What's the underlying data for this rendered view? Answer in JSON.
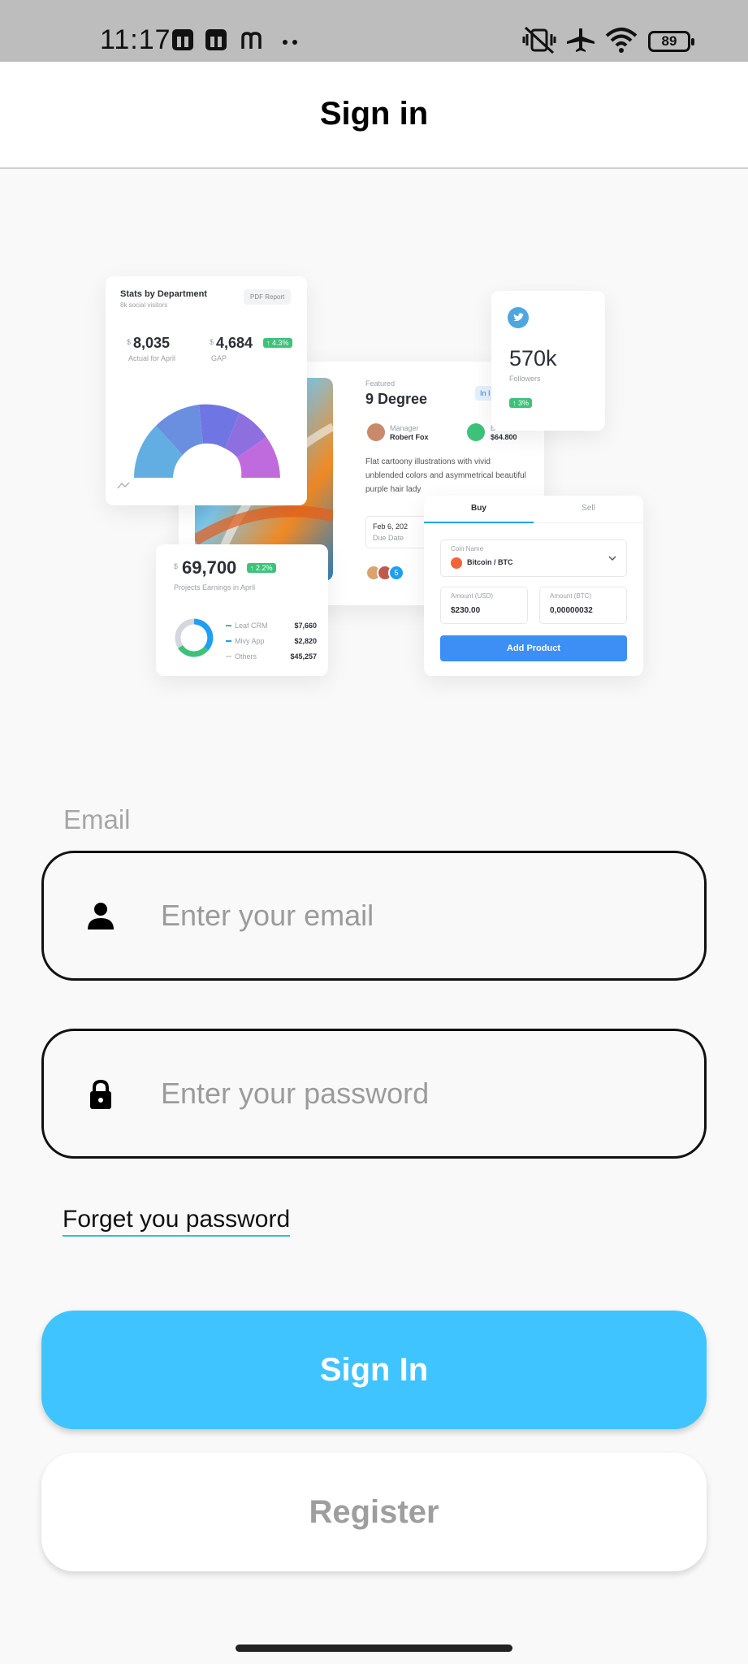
{
  "status_bar": {
    "time": "11:17",
    "battery": "89",
    "icons": [
      "notification-app-icon",
      "notification-app-icon",
      "m-app-icon",
      "more-dots-icon",
      "vibrate-off-icon",
      "airplane-icon",
      "wifi-icon",
      "battery-icon"
    ]
  },
  "appbar": {
    "title": "Sign in"
  },
  "illustration": {
    "stats_card": {
      "title": "Stats by Department",
      "subtitle": "8k social visitors",
      "report_button": "PDF Report",
      "value1_currency": "$",
      "value1": "8,035",
      "value1_label": "Actual for April",
      "value2_currency": "$",
      "value2": "4,684",
      "value2_badge": "↑ 4.3%",
      "value2_label": "GAP"
    },
    "featured_card": {
      "label": "Featured",
      "title": "9 Degree",
      "tag": "In I",
      "manager_label": "Manager",
      "manager_name": "Robert Fox",
      "budget_label": "B",
      "budget_value": "$64.800",
      "description": "Flat cartoony illustrations with vivid unblended colors and asymmetrical beautiful purple hair lady",
      "date": "Feb 6, 202",
      "date_label": "Due Date",
      "avatar_extra": "5"
    },
    "twitter_card": {
      "value": "570k",
      "label": "Followers",
      "badge": "↑ 3%"
    },
    "earnings_card": {
      "currency": "$",
      "value": "69,700",
      "badge": "↑ 2.2%",
      "label": "Projects Earnings in April",
      "rows": [
        {
          "name": "Leaf CRM",
          "value": "$7,660",
          "color": "#3ec27a"
        },
        {
          "name": "Mivy App",
          "value": "$2,820",
          "color": "#1e9ff2"
        },
        {
          "name": "Others",
          "value": "$45,257",
          "color": "#d4d8de"
        }
      ]
    },
    "trade_card": {
      "tab_buy": "Buy",
      "tab_sell": "Sell",
      "coin_label": "Coin Name",
      "coin_value": "Bitcoin / BTC",
      "usd_label": "Amount (USD)",
      "usd_value": "$230.00",
      "btc_label": "Amount (BTC)",
      "btc_value": "0,00000032",
      "button": "Add Product"
    }
  },
  "form": {
    "email_label": "Email",
    "email_placeholder": "Enter your email",
    "email_value": "",
    "password_placeholder": "Enter your password",
    "password_value": "",
    "forgot_link": "Forget you password",
    "signin_button": "Sign In",
    "register_button": "Register"
  },
  "colors": {
    "accent": "#40c4ff",
    "status_bar_bg": "#bdbdbd",
    "page_bg": "#f9f9f9",
    "appbar_bg": "#ffffff",
    "register_text": "#9e9e9e",
    "placeholder": "#9b9b9b"
  }
}
